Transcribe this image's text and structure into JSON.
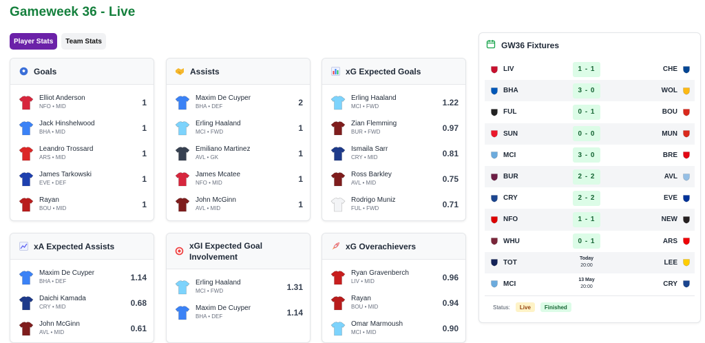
{
  "page": {
    "title": "Gameweek 36 - Live"
  },
  "tabs": [
    {
      "label": "Player Stats",
      "active": true
    },
    {
      "label": "Team Stats",
      "active": false
    }
  ],
  "cards": [
    {
      "title": "Goals",
      "icon": "soccer-ball-icon",
      "players": [
        {
          "name": "Elliot Anderson",
          "team": "NFO",
          "pos": "MID",
          "value": "1",
          "kit": "#d7263d"
        },
        {
          "name": "Jack Hinshelwood",
          "team": "BHA",
          "pos": "MID",
          "value": "1",
          "kit": "#3b82f6"
        },
        {
          "name": "Leandro Trossard",
          "team": "ARS",
          "pos": "MID",
          "value": "1",
          "kit": "#dc2626"
        },
        {
          "name": "James Tarkowski",
          "team": "EVE",
          "pos": "DEF",
          "value": "1",
          "kit": "#1e40af"
        },
        {
          "name": "Rayan",
          "team": "BOU",
          "pos": "MID",
          "value": "1",
          "kit": "#b91c1c"
        }
      ]
    },
    {
      "title": "Assists",
      "icon": "handshake-icon",
      "players": [
        {
          "name": "Maxim De Cuyper",
          "team": "BHA",
          "pos": "DEF",
          "value": "2",
          "kit": "#3b82f6"
        },
        {
          "name": "Erling Haaland",
          "team": "MCI",
          "pos": "FWD",
          "value": "1",
          "kit": "#7dd3fc"
        },
        {
          "name": "Emiliano Martinez",
          "team": "AVL",
          "pos": "GK",
          "value": "1",
          "kit": "#374151"
        },
        {
          "name": "James Mcatee",
          "team": "NFO",
          "pos": "MID",
          "value": "1",
          "kit": "#d7263d"
        },
        {
          "name": "John McGinn",
          "team": "AVL",
          "pos": "MID",
          "value": "1",
          "kit": "#7f1d1d"
        }
      ]
    },
    {
      "title": "xG Expected Goals",
      "icon": "bar-chart-icon",
      "players": [
        {
          "name": "Erling Haaland",
          "team": "MCI",
          "pos": "FWD",
          "value": "1.22",
          "kit": "#7dd3fc"
        },
        {
          "name": "Zian Flemming",
          "team": "BUR",
          "pos": "FWD",
          "value": "0.97",
          "kit": "#7f1d1d"
        },
        {
          "name": "Ismaila Sarr",
          "team": "CRY",
          "pos": "MID",
          "value": "0.81",
          "kit": "#1e3a8a"
        },
        {
          "name": "Ross Barkley",
          "team": "AVL",
          "pos": "MID",
          "value": "0.75",
          "kit": "#7f1d1d"
        },
        {
          "name": "Rodrigo Muniz",
          "team": "FUL",
          "pos": "FWD",
          "value": "0.71",
          "kit": "#f3f4f6"
        }
      ]
    },
    {
      "title": "xA Expected Assists",
      "icon": "trend-chart-icon",
      "players": [
        {
          "name": "Maxim De Cuyper",
          "team": "BHA",
          "pos": "DEF",
          "value": "1.14",
          "kit": "#3b82f6"
        },
        {
          "name": "Daichi Kamada",
          "team": "CRY",
          "pos": "MID",
          "value": "0.68",
          "kit": "#1e3a8a"
        },
        {
          "name": "John McGinn",
          "team": "AVL",
          "pos": "MID",
          "value": "0.61",
          "kit": "#7f1d1d"
        }
      ]
    },
    {
      "title": "xGI Expected Goal Involvement",
      "icon": "target-icon",
      "players": [
        {
          "name": "Erling Haaland",
          "team": "MCI",
          "pos": "FWD",
          "value": "1.31",
          "kit": "#7dd3fc"
        },
        {
          "name": "Maxim De Cuyper",
          "team": "BHA",
          "pos": "DEF",
          "value": "1.14",
          "kit": "#3b82f6"
        }
      ]
    },
    {
      "title": "xG Overachievers",
      "icon": "rocket-icon",
      "players": [
        {
          "name": "Ryan Gravenberch",
          "team": "LIV",
          "pos": "MID",
          "value": "0.96",
          "kit": "#c81e1e"
        },
        {
          "name": "Rayan",
          "team": "BOU",
          "pos": "MID",
          "value": "0.94",
          "kit": "#b91c1c"
        },
        {
          "name": "Omar Marmoush",
          "team": "MCI",
          "pos": "MID",
          "value": "0.90",
          "kit": "#7dd3fc"
        }
      ]
    }
  ],
  "fixtures": {
    "title": "GW36 Fixtures",
    "icon": "calendar-icon",
    "rows": [
      {
        "home": "LIV",
        "away": "CHE",
        "score": "1 - 1",
        "hc": "#c8102e",
        "ac": "#034694"
      },
      {
        "home": "BHA",
        "away": "WOL",
        "score": "3 - 0",
        "hc": "#0057b8",
        "ac": "#fdb913"
      },
      {
        "home": "FUL",
        "away": "BOU",
        "score": "0 - 1",
        "hc": "#222222",
        "ac": "#da291c"
      },
      {
        "home": "SUN",
        "away": "MUN",
        "score": "0 - 0",
        "hc": "#eb172b",
        "ac": "#da291c"
      },
      {
        "home": "MCI",
        "away": "BRE",
        "score": "3 - 0",
        "hc": "#6cabdd",
        "ac": "#e30613"
      },
      {
        "home": "BUR",
        "away": "AVL",
        "score": "2 - 2",
        "hc": "#6c1d45",
        "ac": "#95bfe5"
      },
      {
        "home": "CRY",
        "away": "EVE",
        "score": "2 - 2",
        "hc": "#1b458f",
        "ac": "#003399"
      },
      {
        "home": "NFO",
        "away": "NEW",
        "score": "1 - 1",
        "hc": "#dd0000",
        "ac": "#241f20"
      },
      {
        "home": "WHU",
        "away": "ARS",
        "score": "0 - 1",
        "hc": "#7a263a",
        "ac": "#ef0107"
      },
      {
        "home": "TOT",
        "away": "LEE",
        "score": "",
        "date": "Today",
        "time": "20:00",
        "hc": "#132257",
        "ac": "#ffcd00"
      },
      {
        "home": "MCI",
        "away": "CRY",
        "score": "",
        "date": "13 May",
        "time": "20:00",
        "hc": "#6cabdd",
        "ac": "#1b458f"
      }
    ],
    "status_label": "Status:",
    "badges": [
      "Live",
      "Finished"
    ]
  }
}
